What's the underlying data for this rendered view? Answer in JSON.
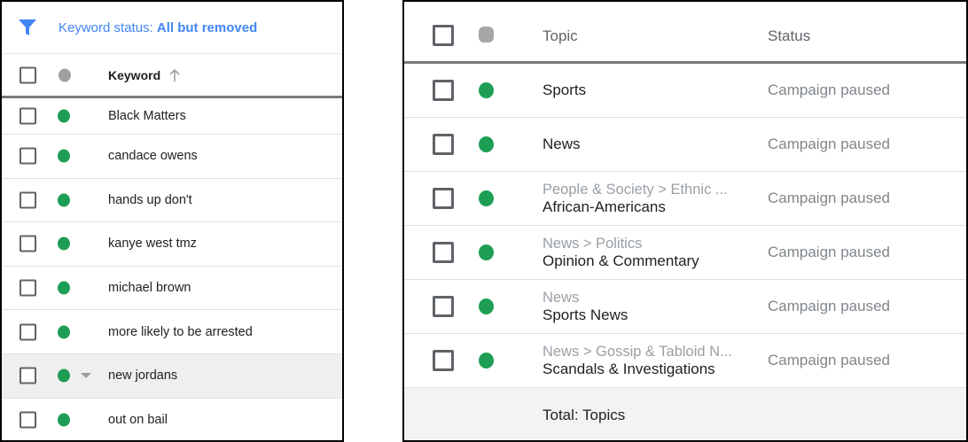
{
  "left": {
    "filter": {
      "label": "Keyword status: ",
      "value": "All but removed"
    },
    "header": {
      "keyword": "Keyword"
    },
    "rows": [
      {
        "keyword": "Black Matters"
      },
      {
        "keyword": "candace owens"
      },
      {
        "keyword": "hands up don't"
      },
      {
        "keyword": "kanye west tmz"
      },
      {
        "keyword": "michael brown"
      },
      {
        "keyword": "more likely to be arrested"
      },
      {
        "keyword": "new jordans"
      },
      {
        "keyword": "out on bail"
      }
    ]
  },
  "right": {
    "header": {
      "topic": "Topic",
      "status": "Status"
    },
    "rows": [
      {
        "topic": "Sports",
        "status": "Campaign paused"
      },
      {
        "topic": "News",
        "status": "Campaign paused"
      },
      {
        "path": "People & Society > Ethnic ...",
        "topic": "African-Americans",
        "status": "Campaign paused"
      },
      {
        "path": "News > Politics",
        "topic": "Opinion & Commentary",
        "status": "Campaign paused"
      },
      {
        "path": "News",
        "topic": "Sports News",
        "status": "Campaign paused"
      },
      {
        "path": "News > Gossip & Tabloid N...",
        "topic": "Scandals & Investigations",
        "status": "Campaign paused"
      }
    ],
    "total": "Total: Topics"
  },
  "colors": {
    "enabled": "#1e9e55",
    "header_dot": "#a0a0a0",
    "accent": "#4285f4"
  },
  "icons": {
    "filter": "filter-icon",
    "sort": "arrow-up-icon",
    "caret": "caret-down-icon"
  }
}
